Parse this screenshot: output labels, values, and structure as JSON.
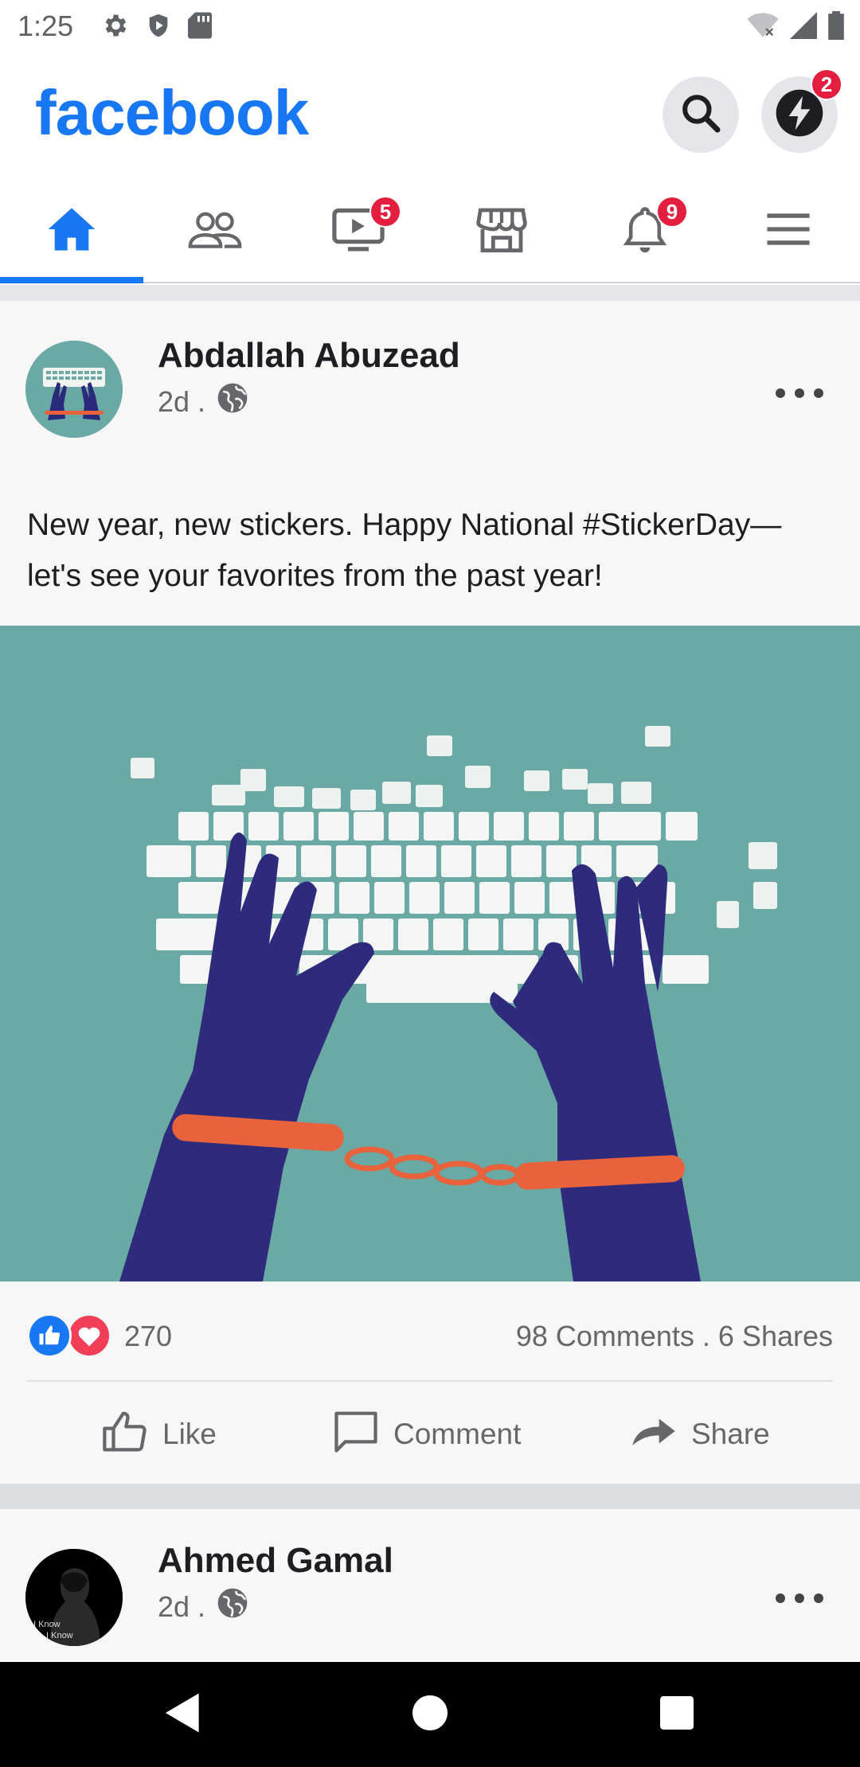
{
  "status_bar": {
    "time": "1:25",
    "icons": [
      "settings-icon",
      "shield-icon",
      "sd-card-icon",
      "wifi-off-icon",
      "signal-icon",
      "battery-icon"
    ]
  },
  "header": {
    "logo": "facebook",
    "search_icon": "search-icon",
    "messenger_icon": "bolt-icon",
    "messenger_badge": "2",
    "brand_color": "#1877f2"
  },
  "tabs": [
    {
      "name": "home",
      "icon": "home-icon",
      "active": true
    },
    {
      "name": "friends",
      "icon": "friends-icon"
    },
    {
      "name": "watch",
      "icon": "video-icon",
      "badge": "5"
    },
    {
      "name": "marketplace",
      "icon": "marketplace-icon"
    },
    {
      "name": "notifications",
      "icon": "bell-icon",
      "badge": "9"
    },
    {
      "name": "menu",
      "icon": "menu-icon"
    }
  ],
  "posts": [
    {
      "author": "Abdallah Abuzead",
      "time": "2d .",
      "privacy_icon": "globe-icon",
      "text": "New year, new stickers. Happy National #StickerDay—let's see your favorites from the past year!",
      "image": "handcuffed-hands-keyboard",
      "reactions_count": "270",
      "stats": "98 Comments . 6 Shares",
      "actions": {
        "like": "Like",
        "comment": "Comment",
        "share": "Share"
      }
    },
    {
      "author": "Ahmed Gamal",
      "time": "2d .",
      "privacy_icon": "globe-icon",
      "avatar_text_1": "I Know",
      "avatar_text_2": "I Know"
    }
  ],
  "nav_bar": {
    "back": "back-icon",
    "home": "home-circle-icon",
    "recents": "recents-icon"
  }
}
